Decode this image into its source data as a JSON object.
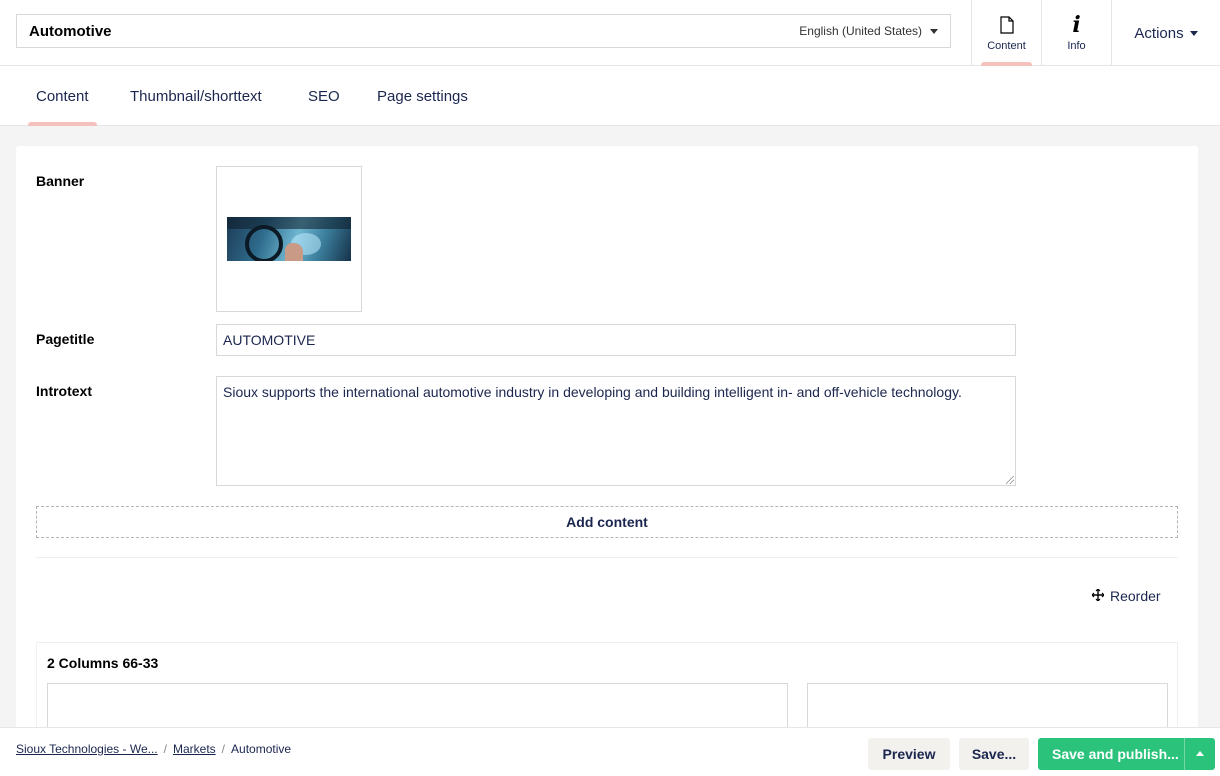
{
  "header": {
    "node_name": "Automotive",
    "language": "English (United States)",
    "apps": [
      {
        "label": "Content",
        "icon": "document-icon"
      },
      {
        "label": "Info",
        "icon": "info-icon"
      }
    ],
    "actions_label": "Actions"
  },
  "tabs": [
    "Content",
    "Thumbnail/shorttext",
    "SEO",
    "Page settings"
  ],
  "content": {
    "banner_label": "Banner",
    "pagetitle_label": "Pagetitle",
    "pagetitle_value": "AUTOMOTIVE",
    "introtext_label": "Introtext",
    "introtext_value": "Sioux supports the international automotive industry in developing and building intelligent in- and off-vehicle technology.",
    "add_content_label": "Add content",
    "reorder_label": "Reorder",
    "grid_title": "2 Columns 66-33"
  },
  "footer": {
    "breadcrumbs": [
      "Sioux Technologies - We...",
      "Markets",
      "Automotive"
    ],
    "preview_label": "Preview",
    "save_label": "Save...",
    "save_publish_label": "Save and publish..."
  },
  "colors": {
    "primary_text": "#1b264f",
    "accent_tab": "#f5c1bc",
    "success": "#2bc37c",
    "background": "#f5f4f4"
  }
}
